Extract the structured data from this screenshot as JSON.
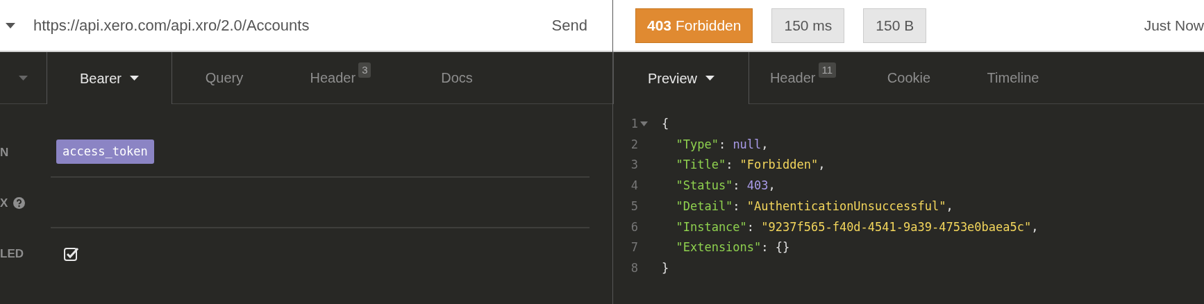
{
  "request_bar": {
    "url": "https://api.xero.com/api.xro/2.0/Accounts",
    "send": "Send"
  },
  "response_bar": {
    "status": "**403** Forbidden",
    "time": "150 ms",
    "size": "150 B",
    "when": "Just Now"
  },
  "request_tabs": [
    {
      "kind": "caret",
      "selected": false
    },
    {
      "kind": "dropdown",
      "label": "Bearer",
      "selected": true
    },
    {
      "kind": "plain",
      "label": "Query",
      "selected": false
    },
    {
      "kind": "plain",
      "label": "Header",
      "badge": "3",
      "selected": false
    },
    {
      "kind": "plain",
      "label": "Docs",
      "selected": false
    }
  ],
  "auth_form": [
    {
      "kind": "token",
      "label": "N",
      "value": "access_token"
    },
    {
      "kind": "help",
      "label": "X"
    },
    {
      "kind": "checkbox",
      "label": "LED",
      "checked": true
    }
  ],
  "response_tabs": [
    {
      "kind": "dropdown",
      "label": "Preview",
      "selected": true
    },
    {
      "kind": "plain",
      "label": "Header",
      "badge": "11",
      "selected": false
    },
    {
      "kind": "plain",
      "label": "Cookie",
      "selected": false
    },
    {
      "kind": "plain",
      "label": "Timeline",
      "selected": false
    }
  ],
  "body": [
    {
      "number": "1",
      "foldable": true,
      "tokens": [
        {
          "kind": "punct",
          "text": "{"
        }
      ]
    },
    {
      "number": "2",
      "tokens": [
        {
          "kind": "key",
          "text": "  \"Type\""
        },
        {
          "kind": "punct",
          "text": ": "
        },
        {
          "kind": "null",
          "text": "null"
        },
        {
          "kind": "punct",
          "text": ","
        }
      ]
    },
    {
      "number": "3",
      "tokens": [
        {
          "kind": "key",
          "text": "  \"Title\""
        },
        {
          "kind": "punct",
          "text": ": "
        },
        {
          "kind": "string",
          "text": "\"Forbidden\""
        },
        {
          "kind": "punct",
          "text": ","
        }
      ]
    },
    {
      "number": "4",
      "tokens": [
        {
          "kind": "key",
          "text": "  \"Status\""
        },
        {
          "kind": "punct",
          "text": ": "
        },
        {
          "kind": "number",
          "text": "403"
        },
        {
          "kind": "punct",
          "text": ","
        }
      ]
    },
    {
      "number": "5",
      "tokens": [
        {
          "kind": "key",
          "text": "  \"Detail\""
        },
        {
          "kind": "punct",
          "text": ": "
        },
        {
          "kind": "string",
          "text": "\"AuthenticationUnsuccessful\""
        },
        {
          "kind": "punct",
          "text": ","
        }
      ]
    },
    {
      "number": "6",
      "tokens": [
        {
          "kind": "key",
          "text": "  \"Instance\""
        },
        {
          "kind": "punct",
          "text": ": "
        },
        {
          "kind": "string",
          "text": "\"9237f565-f40d-4541-9a39-4753e0baea5c\""
        },
        {
          "kind": "punct",
          "text": ","
        }
      ]
    },
    {
      "number": "7",
      "tokens": [
        {
          "kind": "key",
          "text": "  \"Extensions\""
        },
        {
          "kind": "punct",
          "text": ": {}"
        }
      ]
    },
    {
      "number": "8",
      "tokens": [
        {
          "kind": "punct",
          "text": "}"
        }
      ]
    }
  ]
}
